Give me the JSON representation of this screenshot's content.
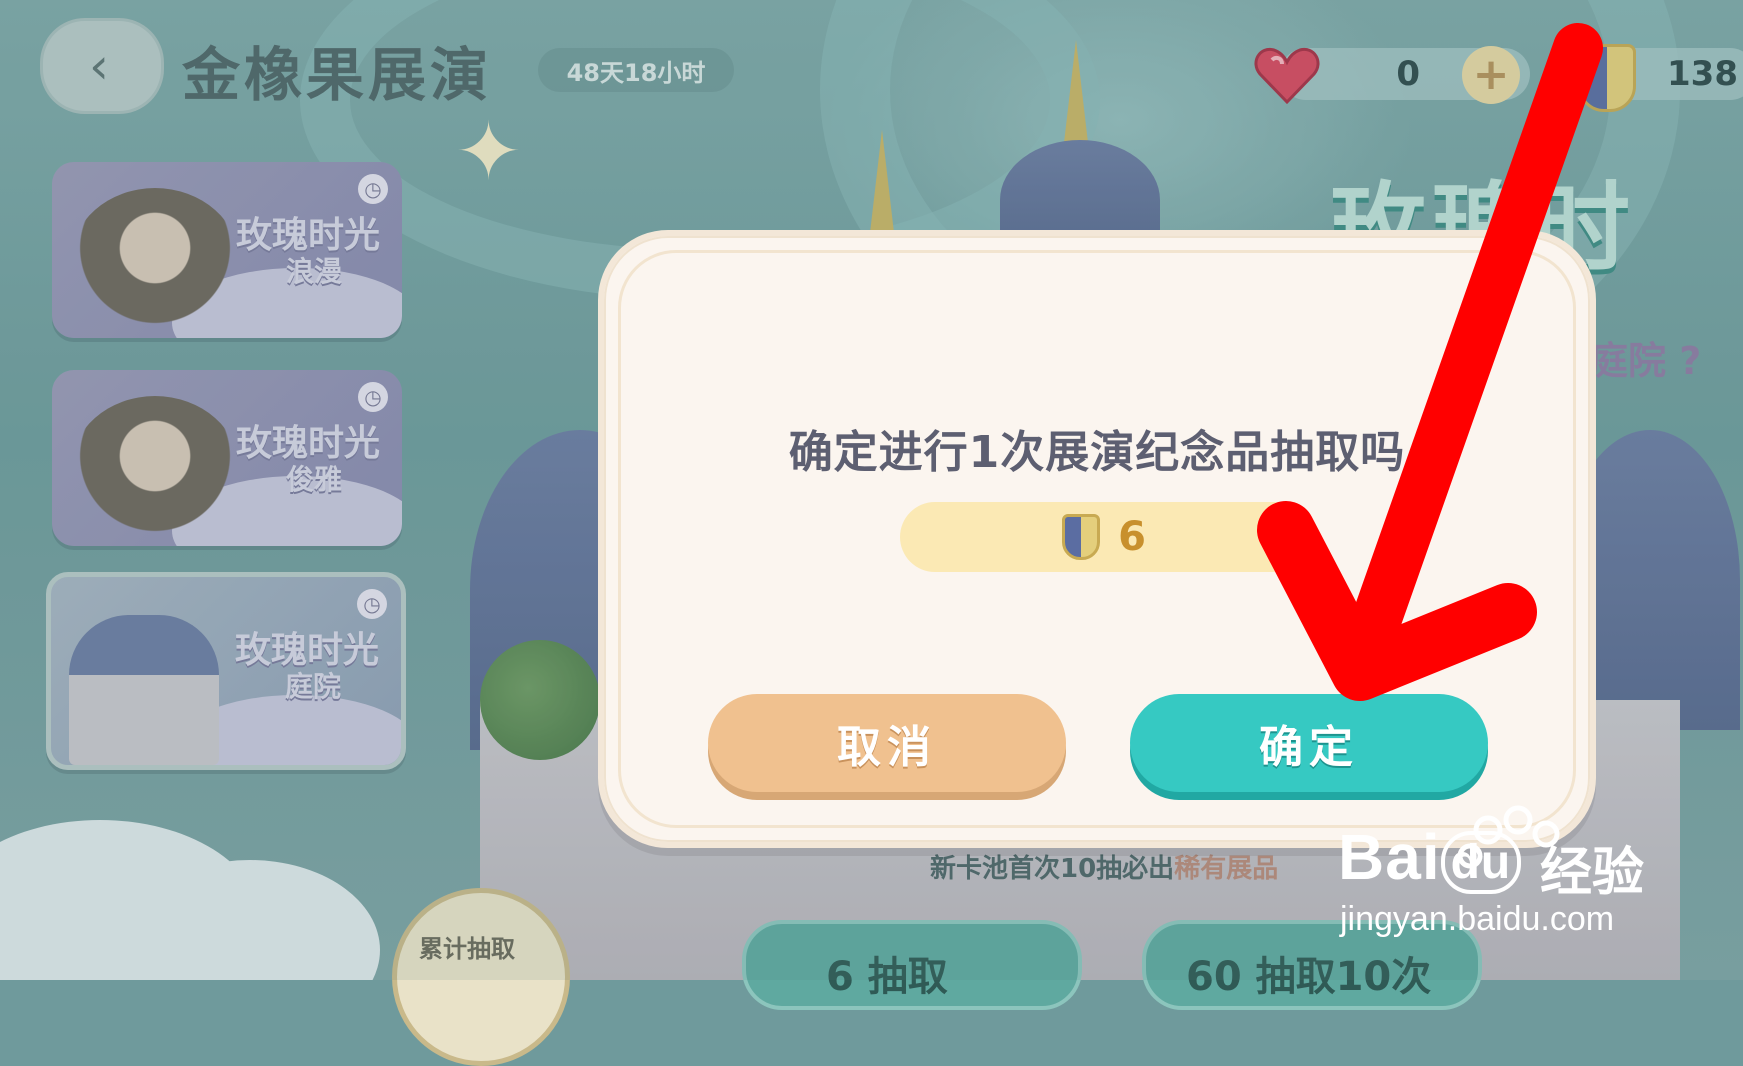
{
  "header": {
    "back_label": "‹",
    "title": "金橡果展演",
    "timer": "48天18小时",
    "hearts_value": "0",
    "plus_label": "+",
    "tickets_value": "138"
  },
  "side_cards": [
    {
      "name": "玫瑰时光",
      "sub": "浪漫"
    },
    {
      "name": "玫瑰时光",
      "sub": "俊雅"
    },
    {
      "name": "玫瑰时光",
      "sub": "庭院"
    }
  ],
  "clock_glyph": "◷",
  "background_text": {
    "banner": "玫瑰时",
    "banner_sub": "庭院 ?",
    "hint_prefix": "新卡池首次10抽必出",
    "hint_highlight": "稀有展品",
    "accum_label": "累计抽取",
    "draw_one": "6  抽取",
    "draw_ten": "60 抽取10次"
  },
  "dialog": {
    "question": "确定进行1次展演纪念品抽取吗",
    "cost_value": "6",
    "cancel_label": "取消",
    "confirm_label": "确定"
  },
  "watermark": {
    "brand": "Bai",
    "brand_du": "du",
    "suffix": "经验",
    "url": "jingyan.baidu.com"
  },
  "colors": {
    "confirm": "#36c9c2",
    "cancel": "#f0c18f",
    "annotation_arrow": "#ff0000"
  }
}
